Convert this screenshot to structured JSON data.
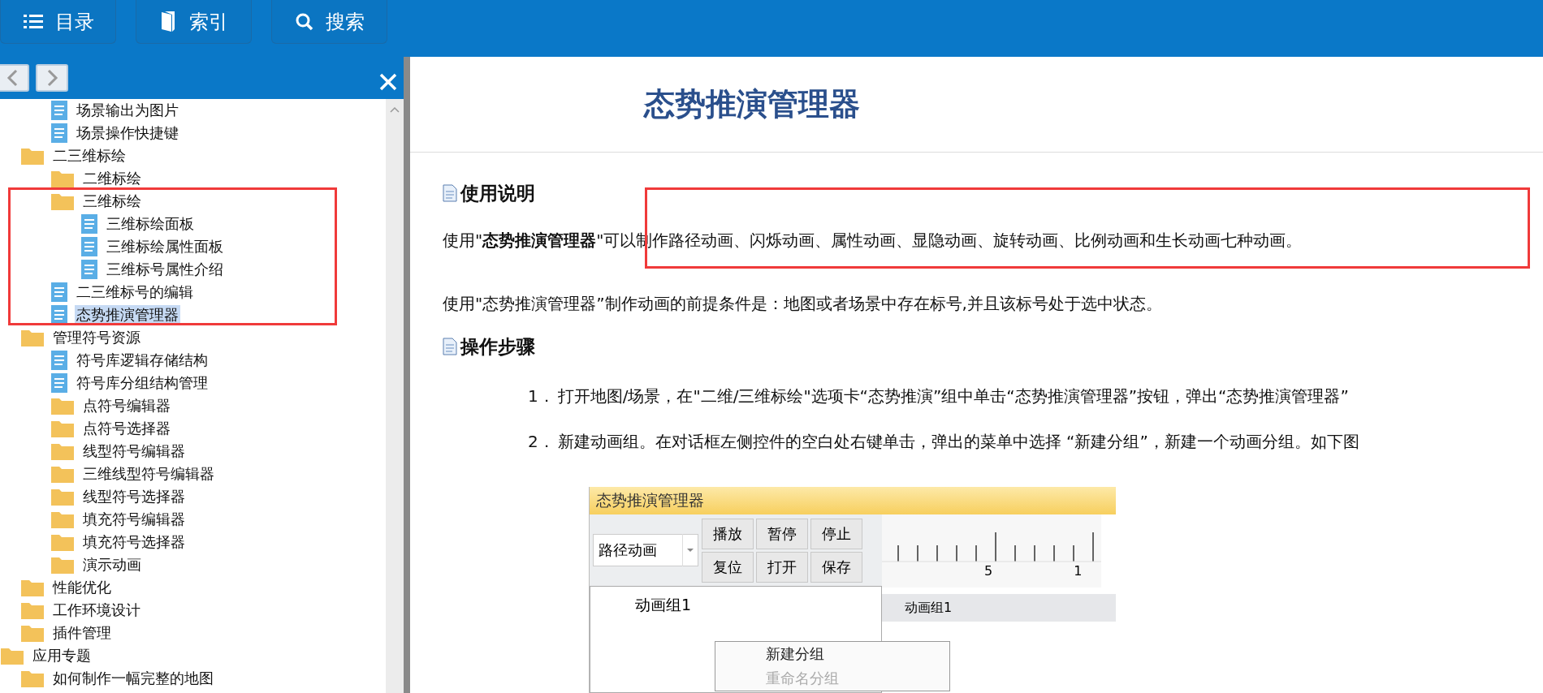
{
  "toolbar": [
    {
      "kind": "contents",
      "label": "目录"
    },
    {
      "kind": "index",
      "label": "索引"
    },
    {
      "kind": "search",
      "label": "搜索"
    }
  ],
  "tree": [
    {
      "children": [
        {
          "children": [
            {
              "kind": "page",
              "label": "场景输出为图片",
              "selected": false
            },
            {
              "kind": "page",
              "label": "场景操作快捷键",
              "selected": false
            }
          ]
        },
        {
          "kind": "folder",
          "label": "二三维标绘",
          "selected": false,
          "children": [
            {
              "kind": "folder",
              "label": "二维标绘",
              "selected": false
            },
            {
              "kind": "folder",
              "label": "三维标绘",
              "selected": false,
              "children": [
                {
                  "kind": "page",
                  "label": "三维标绘面板",
                  "selected": false
                },
                {
                  "kind": "page",
                  "label": "三维标绘属性面板",
                  "selected": false
                },
                {
                  "kind": "page",
                  "label": "三维标号属性介绍",
                  "selected": false
                }
              ]
            },
            {
              "kind": "page",
              "label": "二三维标号的编辑",
              "selected": false
            },
            {
              "kind": "page",
              "label": "态势推演管理器",
              "selected": true
            }
          ]
        },
        {
          "kind": "folder",
          "label": "管理符号资源",
          "selected": false,
          "children": [
            {
              "kind": "page",
              "label": "符号库逻辑存储结构",
              "selected": false
            },
            {
              "kind": "page",
              "label": "符号库分组结构管理",
              "selected": false
            },
            {
              "kind": "folder",
              "label": "点符号编辑器",
              "selected": false
            },
            {
              "kind": "folder",
              "label": "点符号选择器",
              "selected": false
            },
            {
              "kind": "folder",
              "label": "线型符号编辑器",
              "selected": false
            },
            {
              "kind": "folder",
              "label": "三维线型符号编辑器",
              "selected": false
            },
            {
              "kind": "folder",
              "label": "线型符号选择器",
              "selected": false
            },
            {
              "kind": "folder",
              "label": "填充符号编辑器",
              "selected": false
            },
            {
              "kind": "folder",
              "label": "填充符号选择器",
              "selected": false
            },
            {
              "kind": "folder",
              "label": "演示动画",
              "selected": false
            }
          ]
        },
        {
          "kind": "folder",
          "label": "性能优化",
          "selected": false
        },
        {
          "kind": "folder",
          "label": "工作环境设计",
          "selected": false
        },
        {
          "kind": "folder",
          "label": "插件管理",
          "selected": false
        }
      ]
    },
    {
      "kind": "folder",
      "label": "应用专题",
      "selected": false,
      "children": [
        {
          "kind": "folder",
          "label": "如何制作一幅完整的地图",
          "selected": false
        }
      ]
    }
  ],
  "article": {
    "title": "态势推演管理器",
    "sections": [
      {
        "heading": "使用说明",
        "paragraphs": [
          "使用\"**态势推演管理器**\"可以制作路径动画、闪烁动画、属性动画、显隐动画、旋转动画、比例动画和生长动画七种动画。",
          "使用\"态势推演管理器”制作动画的前提条件是：地图或者场景中存在标号,并且该标号处于选中状态。"
        ]
      },
      {
        "heading": "操作步骤",
        "steps": [
          {
            "number": "1．",
            "text": "打开地图/场景，在\"二维/三维标绘\"选项卡“态势推演”组中单击“态势推演管理器”按钮，弹出“态势推演管理器”"
          },
          {
            "number": "2．",
            "text": "新建动画组。在对话框左侧控件的空白处右键单击，弹出的菜单中选择 “新建分组”，新建一个动画分组。如下图"
          }
        ]
      }
    ],
    "figure": {
      "title": "态势推演管理器",
      "dropdown": "路径动画",
      "buttons": [
        "播放",
        "暂停",
        "停止",
        "复位",
        "打开",
        "保存"
      ],
      "tree_item": "动画组1",
      "ruler_labels": [
        "5",
        "1"
      ],
      "track_label": "动画组1",
      "menu": [
        {
          "label": "新建分组",
          "disabled": false
        },
        {
          "label": "重命名分组",
          "disabled": true
        }
      ]
    }
  }
}
